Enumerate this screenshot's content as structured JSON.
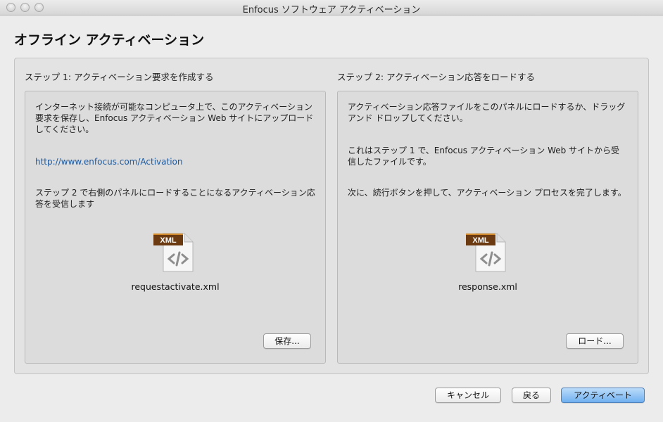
{
  "window": {
    "title": "Enfocus ソフトウェア アクティベーション"
  },
  "header": {
    "title": "オフライン アクティベーション"
  },
  "step1": {
    "title": "ステップ 1: アクティベーション要求を作成する",
    "text1": "インターネット接続が可能なコンピュータ上で、このアクティベーション要求を保存し、Enfocus アクティベーション Web サイトにアップロードしてください。",
    "link": "http://www.enfocus.com/Activation",
    "text2": "ステップ 2 で右側のパネルにロードすることになるアクティベーション応答を受信します",
    "file_badge": "XML",
    "file_name": "requestactivate.xml",
    "button": "保存..."
  },
  "step2": {
    "title": "ステップ 2: アクティベーション応答をロードする",
    "text1": "アクティベーション応答ファイルをこのパネルにロードするか、ドラッグ アンド ドロップしてください。",
    "text2": "これはステップ 1 で、Enfocus アクティベーション Web サイトから受信したファイルです。",
    "text3": "次に、続行ボタンを押して、アクティベーション プロセスを完了します。",
    "file_badge": "XML",
    "file_name": "response.xml",
    "button": "ロード..."
  },
  "footer": {
    "cancel": "キャンセル",
    "back": "戻る",
    "activate": "アクティベート"
  }
}
